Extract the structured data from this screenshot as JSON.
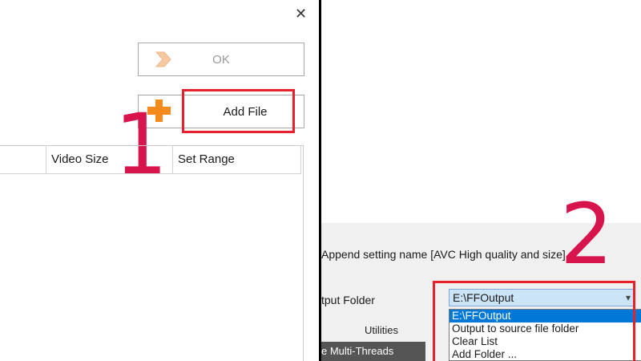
{
  "left_panel": {
    "ok_label": "OK",
    "add_file_label": "Add File",
    "step_number": "1",
    "table": {
      "columns": [
        "",
        "Video Size",
        "Set Range"
      ]
    }
  },
  "right_panel": {
    "append_setting_label": "Append setting name [AVC High quality and size]",
    "output_folder_label": "tput Folder",
    "utilities_tab": "Utilities",
    "multithreads_label": "e Multi-Threads",
    "output_select_value": "E:\\FFOutput",
    "dropdown_options": [
      "E:\\FFOutput",
      "Output to source file folder",
      "Clear List",
      "Add Folder ..."
    ],
    "selected_option_index": 0,
    "step_number": "2"
  },
  "colors": {
    "highlight": "#e8202b",
    "step_number": "#d8144c",
    "selection": "#0078d7",
    "select_bg": "#cce4f7"
  },
  "icons": [
    "close-icon",
    "ok-arrow-icon",
    "plus-icon",
    "chevron-down-icon"
  ]
}
